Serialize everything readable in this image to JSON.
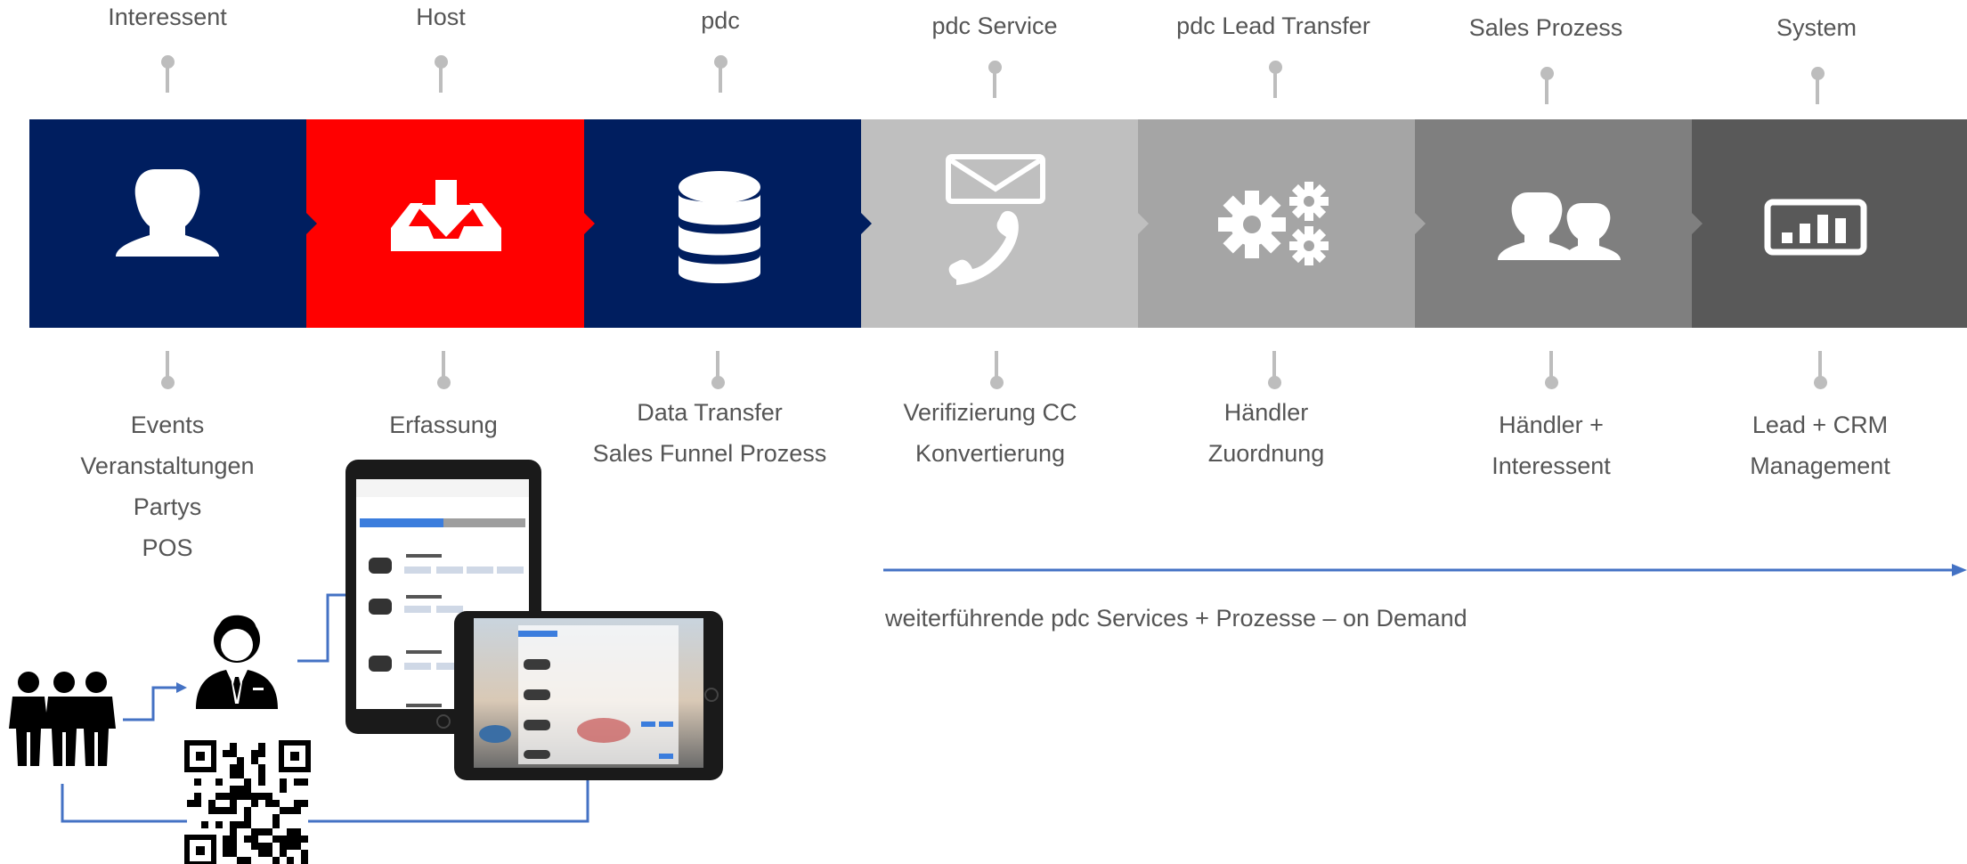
{
  "stages": [
    {
      "role": "Interessent",
      "details": [
        "Events",
        "Veranstaltungen",
        "Partys",
        "POS"
      ],
      "color": "#001e5f",
      "icon": "user-icon"
    },
    {
      "role": "Host",
      "details": [
        "Erfassung"
      ],
      "color": "#ff0000",
      "icon": "download-inbox-icon"
    },
    {
      "role": "pdc",
      "details": [
        "Data Transfer",
        "Sales Funnel Prozess"
      ],
      "color": "#001e5f",
      "icon": "database-icon"
    },
    {
      "role": "pdc Service",
      "details": [
        "Verifizierung CC",
        "Konvertierung"
      ],
      "color": "#bfbfbf",
      "icon": "mail-phone-icon"
    },
    {
      "role": "pdc Lead Transfer",
      "details": [
        "Händler",
        "Zuordnung"
      ],
      "color": "#a5a5a5",
      "icon": "gears-icon"
    },
    {
      "role": "Sales Prozess",
      "details": [
        "Händler +",
        "Interessent"
      ],
      "color": "#7f7f7f",
      "icon": "users-icon"
    },
    {
      "role": "System",
      "details": [
        "Lead + CRM",
        "Management"
      ],
      "color": "#595959",
      "icon": "dashboard-chart-icon"
    }
  ],
  "footnote": "weiterführende pdc Services + Prozesse – on Demand",
  "arrow_color": "#4472c4",
  "illustration_icons": [
    "group-icon",
    "host-person-icon",
    "qr-code-icon",
    "tablet-portrait-icon",
    "tablet-landscape-icon"
  ]
}
